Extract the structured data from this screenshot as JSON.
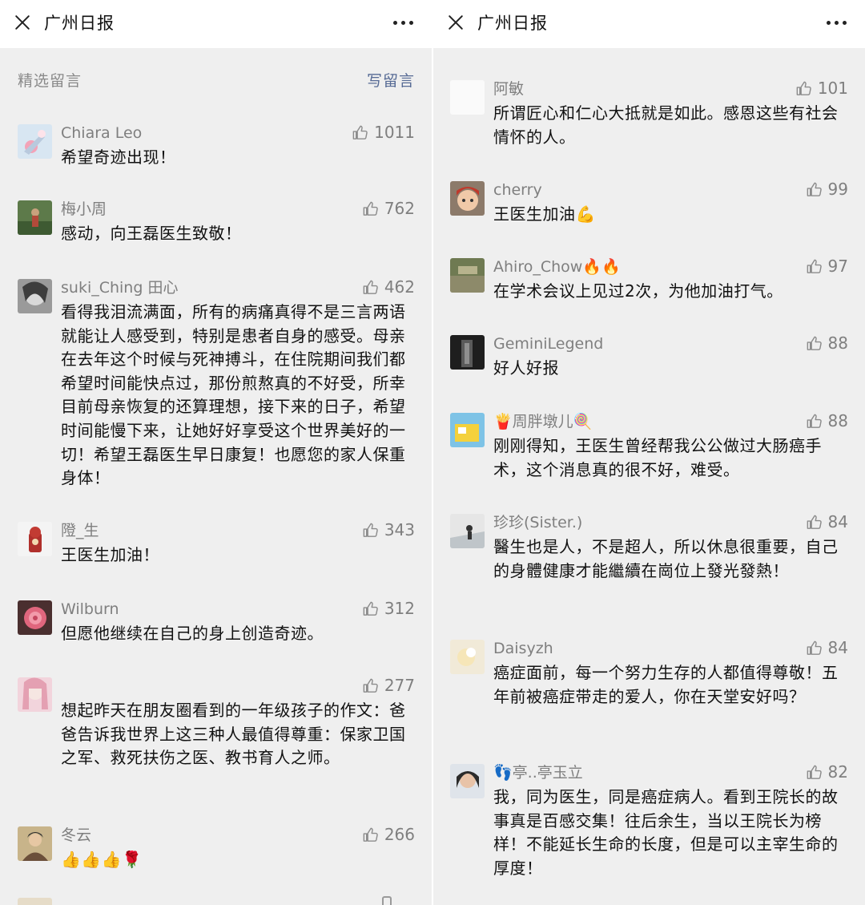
{
  "left": {
    "title": "广州日报",
    "section_label": "精选留言",
    "write_label": "写留言",
    "comments": [
      {
        "name": "Chiara Leo",
        "likes": "1011",
        "text": "希望奇迹出现！"
      },
      {
        "name": "梅小周",
        "likes": "762",
        "text": "感动，向王磊医生致敬！"
      },
      {
        "name": "suki_Ching 田心",
        "likes": "462",
        "text": "看得我泪流满面，所有的病痛真得不是三言两语就能让人感受到，特别是患者自身的感受。母亲在去年这个时候与死神搏斗，在住院期间我们都希望时间能快点过，那份煎熬真的不好受，所幸目前母亲恢复的还算理想，接下来的日子，希望时间能慢下来，让她好好享受这个世界美好的一切！希望王磊医生早日康复！也愿您的家人保重身体！"
      },
      {
        "name": "隥_生",
        "likes": "343",
        "text": "王医生加油！"
      },
      {
        "name": "Wilburn",
        "likes": "312",
        "text": "但愿他继续在自己的身上创造奇迹。"
      },
      {
        "name": "",
        "likes": "277",
        "text": "想起昨天在朋友圈看到的一年级孩子的作文：爸爸告诉我世界上这三种人最值得尊重：保家卫国之军、救死扶伤之医、教书育人之师。"
      },
      {
        "name": "冬云",
        "likes": "266",
        "text": "👍👍👍🌹"
      }
    ]
  },
  "right": {
    "title": "广州日报",
    "comments": [
      {
        "name": "阿敏",
        "likes": "101",
        "text": "所谓匠心和仁心大抵就是如此。感恩这些有社会情怀的人。"
      },
      {
        "name": "cherry",
        "likes": "99",
        "text": "王医生加油💪"
      },
      {
        "name": "Ahiro_Chow🔥🔥",
        "likes": "97",
        "text": "在学术会议上见过2次，为他加油打气。"
      },
      {
        "name": "GeminiLegend",
        "likes": "88",
        "text": "好人好报"
      },
      {
        "name": "🍟周胖墩儿🍭",
        "likes": "88",
        "text": "刚刚得知，王医生曾经帮我公公做过大肠癌手术，这个消息真的很不好，难受。"
      },
      {
        "name": "珍珍(Sister.)",
        "likes": "84",
        "text": "醫生也是人，不是超人，所以休息很重要，自己的身體健康才能繼續在崗位上發光發熱！"
      },
      {
        "name": "Daisyzh",
        "likes": "84",
        "text": "癌症面前，每一个努力生存的人都值得尊敬！五年前被癌症带走的爱人，你在天堂安好吗？"
      },
      {
        "name": "👣亭..亭玉立",
        "likes": "82",
        "text": "我，同为医生，同是癌症病人。看到王院长的故事真是百感交集！往后余生，当以王院长为榜样！不能延长生命的长度，但是可以主宰生命的厚度！"
      }
    ]
  },
  "icons": {
    "close": "close-icon",
    "more": "more-icon",
    "like": "thumbs-up-icon"
  },
  "colors": {
    "link": "#576b95",
    "secondary_text": "#7f7f7f",
    "background": "#efefef"
  }
}
